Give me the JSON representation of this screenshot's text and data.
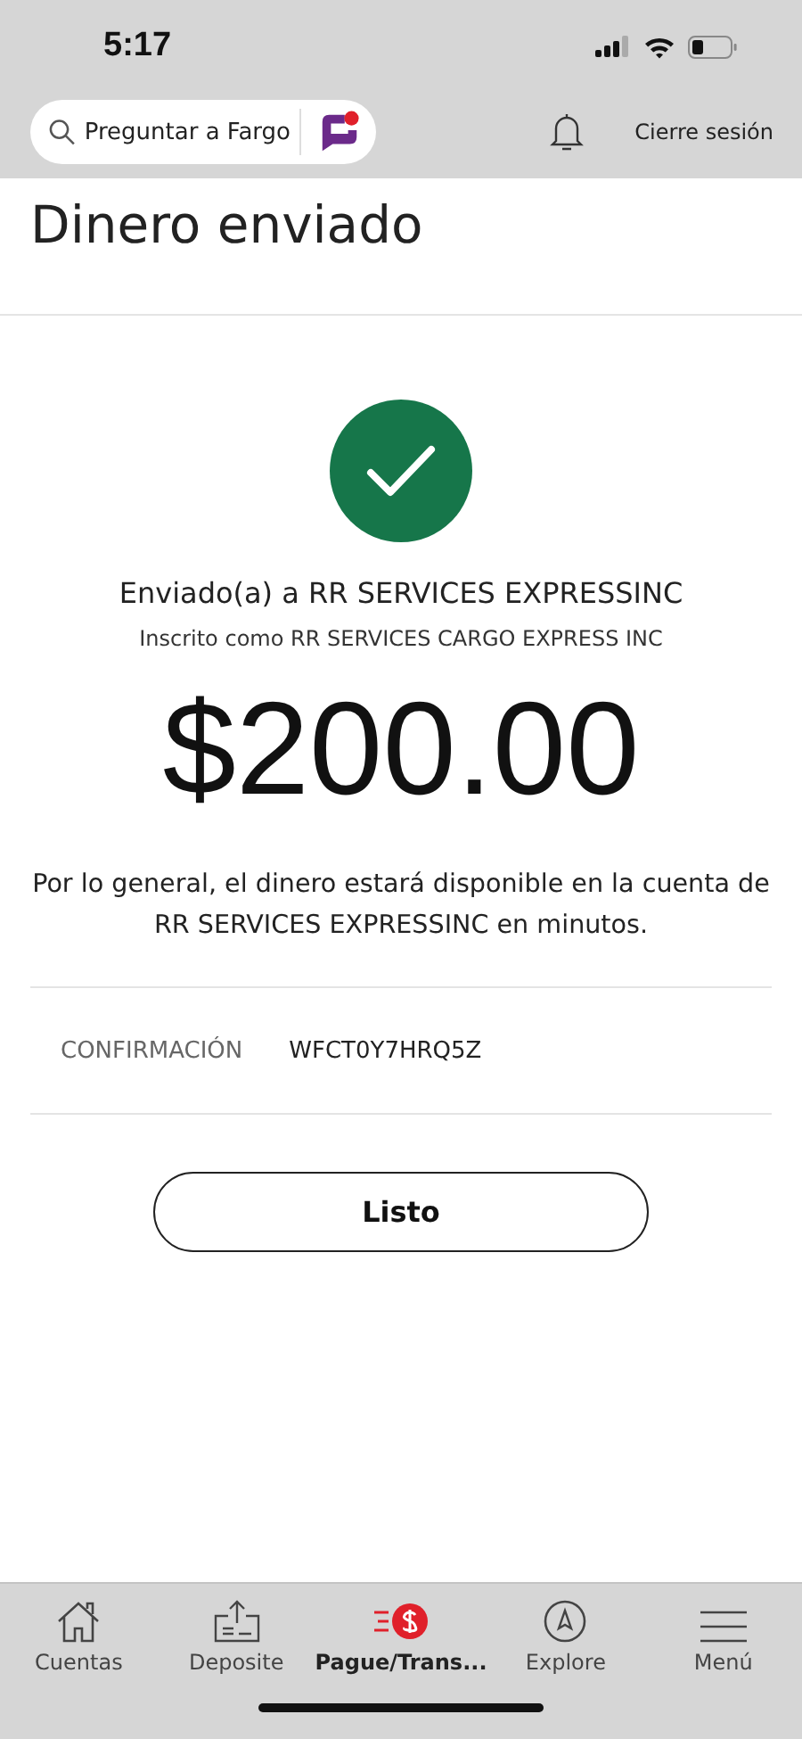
{
  "status_bar": {
    "time": "5:17"
  },
  "header": {
    "search": {
      "placeholder": "Preguntar a Fargo"
    },
    "logout": "Cierre sesión"
  },
  "title": "Dinero enviado",
  "confirmation": {
    "recipient": "Enviado(a) a RR  SERVICES EXPRESSINC",
    "enrolled_as": "Inscrito como RR SERVICES CARGO EXPRESS INC",
    "amount": "$200.00",
    "message": "Por lo general, el dinero estará disponible en la cuenta de RR SERVICES EXPRESSINC en minutos.",
    "label": "CONFIRMACIÓN",
    "code": "WFCT0Y7HRQ5Z"
  },
  "done_button": "Listo",
  "tabs": [
    {
      "kind": "home",
      "label": "Cuentas",
      "selected": false
    },
    {
      "kind": "deposit",
      "label": "Deposite",
      "selected": false
    },
    {
      "kind": "pay",
      "label": "Pague/Trans...",
      "selected": true
    },
    {
      "kind": "explore",
      "label": "Explore",
      "selected": false
    },
    {
      "kind": "menu",
      "label": "Menú",
      "selected": false
    }
  ]
}
